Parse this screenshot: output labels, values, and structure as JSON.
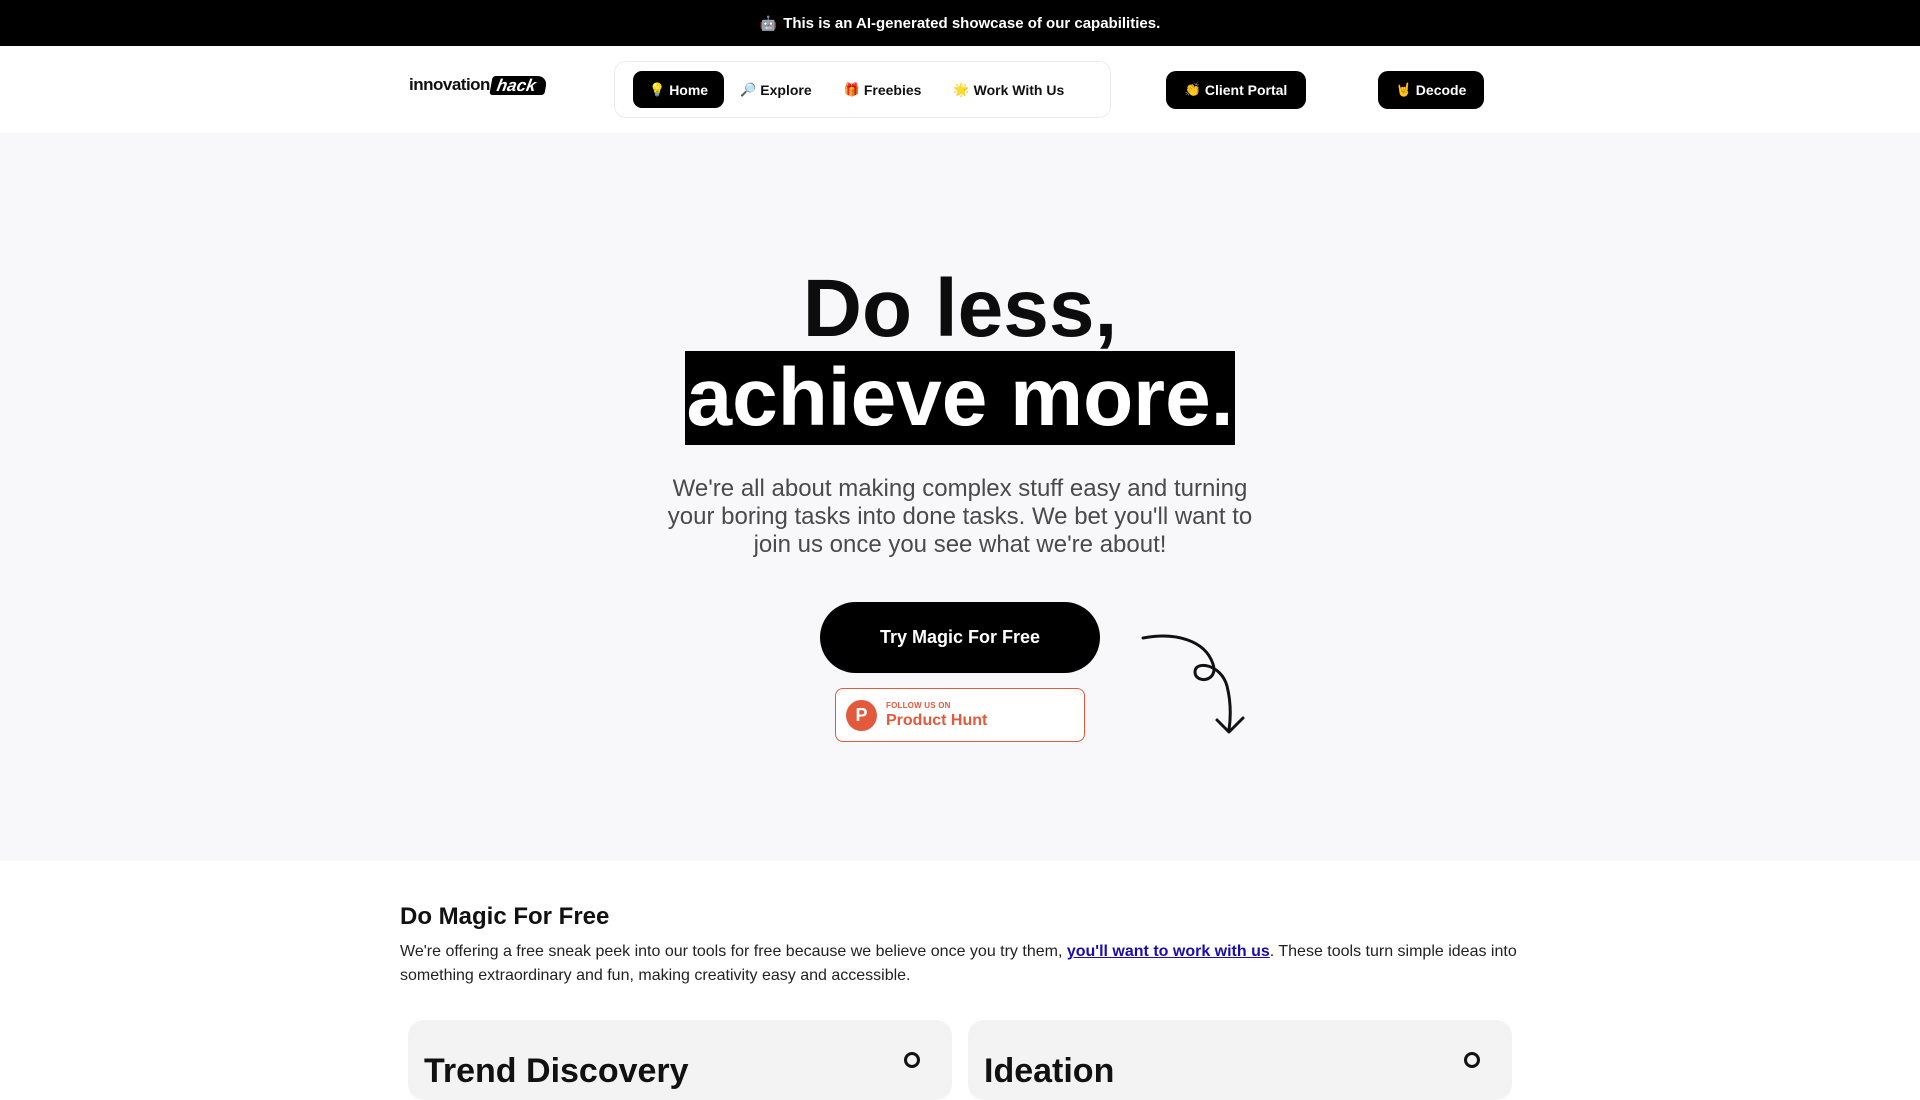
{
  "banner": {
    "icon": "robot-icon",
    "text": "This is an AI-generated showcase of our capabilities."
  },
  "brand": {
    "part1": "innovation",
    "part2": "hack"
  },
  "nav": {
    "items": [
      {
        "icon": "lightbulb-icon",
        "glyph": "💡",
        "label": "Home",
        "active": true
      },
      {
        "icon": "magnifier-icon",
        "glyph": "🔎",
        "label": "Explore",
        "active": false
      },
      {
        "icon": "gift-icon",
        "glyph": "🎁",
        "label": "Freebies",
        "active": false
      },
      {
        "icon": "star-icon",
        "glyph": "🌟",
        "label": "Work With Us",
        "active": false
      }
    ],
    "client_portal": {
      "icon": "clap-icon",
      "glyph": "👏",
      "label": "Client Portal"
    },
    "decode": {
      "icon": "rock-hand-icon",
      "glyph": "🤘",
      "label": "Decode"
    }
  },
  "hero": {
    "headline_line1": "Do less,",
    "headline_line2": "achieve more.",
    "lead": "We're all about making complex stuff easy and turning your boring tasks into done tasks. We bet you'll want to join us once you see what we're about!",
    "cta_label": "Try Magic For Free",
    "product_hunt": {
      "letter": "P",
      "small": "FOLLOW US ON",
      "big": "Product Hunt"
    }
  },
  "section": {
    "title": "Do Magic For Free",
    "text_before": "We're offering a free sneak peek into our tools for free because we believe once you try them, ",
    "link_text": "you'll want to work with us",
    "text_after": ". These tools turn simple ideas into something extraordinary and fun, making creativity easy and accessible."
  },
  "cards": [
    {
      "title": "Trend Discovery"
    },
    {
      "title": "Ideation"
    }
  ],
  "colors": {
    "accent": "#000000",
    "hero_bg": "#f8f8fa",
    "product_hunt": "#e3593c",
    "link": "#1a0dab"
  }
}
